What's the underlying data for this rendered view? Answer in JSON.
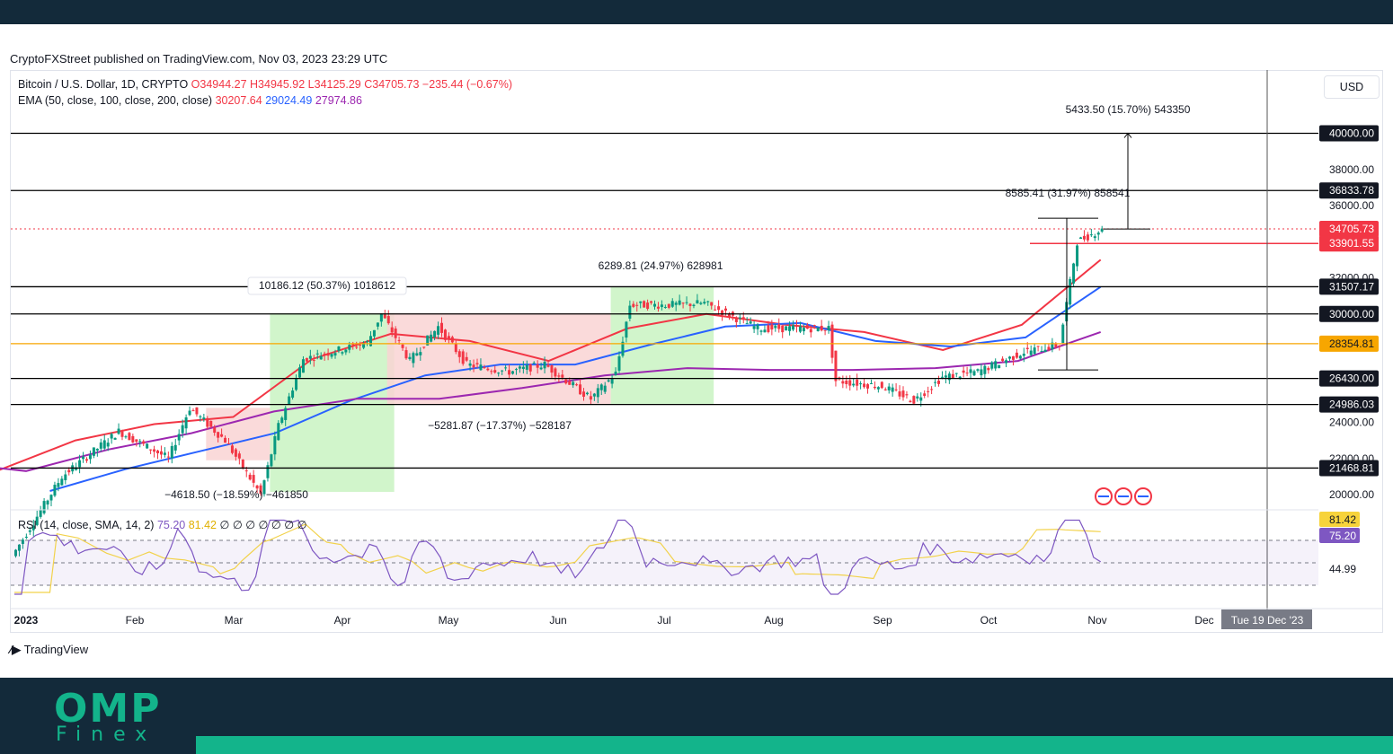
{
  "published": "CryptoFXStreet published on TradingView.com, Nov 03, 2023 23:29 UTC",
  "brand": "TradingView",
  "footer_logo": {
    "top": "OMP",
    "bottom": "Finex"
  },
  "currency_button": "USD",
  "legend": {
    "symbol": "Bitcoin / U.S. Dollar, 1D, CRYPTO",
    "open": "O34944.27",
    "high": "H34945.92",
    "low": "L34125.29",
    "close": "C34705.73",
    "change": "−235.44 (−0.67%)",
    "ema_label": "EMA (50, close, 100, close, 200, close)",
    "ema50": "30207.64",
    "ema100": "29024.49",
    "ema200": "27974.86",
    "rsi_label": "RSI (14, close, SMA, 14, 2)",
    "rsi_value": "75.20",
    "rsi_sma": "81.42",
    "rsi_extra": "∅ ∅ ∅ ∅ ∅ ∅ ∅"
  },
  "colors": {
    "ema50": "#f23645",
    "ema100": "#2962ff",
    "ema200": "#9c27b0",
    "up": "#089981",
    "down": "#f23645",
    "orange": "#f7a600"
  },
  "chart_data": {
    "type": "candlestick",
    "title": "Bitcoin / U.S. Dollar, 1D, CRYPTO",
    "ylim": [
      19500,
      41500
    ],
    "x_ticks": [
      "2023",
      "Feb",
      "Mar",
      "Apr",
      "May",
      "Jun",
      "Jul",
      "Aug",
      "Sep",
      "Oct",
      "Nov",
      "Dec"
    ],
    "y_ticks": [
      "40000.00",
      "38000.00",
      "36000.00",
      "32000.00",
      "24000.00",
      "22000.00",
      "20000.00"
    ],
    "price_labels": [
      {
        "label": "40000.00",
        "value": 40000,
        "kind": "black"
      },
      {
        "label": "36833.78",
        "value": 36833.78,
        "kind": "black"
      },
      {
        "label": "34705.73",
        "value": 34705.73,
        "kind": "red"
      },
      {
        "label": "33901.55",
        "value": 33901.55,
        "kind": "red"
      },
      {
        "label": "31507.17",
        "value": 31507.17,
        "kind": "black"
      },
      {
        "label": "30000.00",
        "value": 30000,
        "kind": "black"
      },
      {
        "label": "28354.81",
        "value": 28354.81,
        "kind": "orange"
      },
      {
        "label": "26430.00",
        "value": 26430,
        "kind": "black"
      },
      {
        "label": "24986.03",
        "value": 24986.03,
        "kind": "black"
      },
      {
        "label": "21468.81",
        "value": 21468.81,
        "kind": "black"
      }
    ],
    "levels": [
      40000,
      36833.78,
      31507.17,
      30000,
      26430,
      24986.03,
      21468.81
    ],
    "orange_level": 28354.81,
    "current_price": 34705.73,
    "annotations": [
      {
        "text": "10186.12 (50.37%) 1018612"
      },
      {
        "text": "6289.81 (24.97%) 628981"
      },
      {
        "text": "−5281.87 (−17.37%) −528187"
      },
      {
        "text": "−4618.50 (−18.59%) −461850"
      },
      {
        "text": "8585.41 (31.97%) 858541"
      },
      {
        "text": "5433.50 (15.70%) 543350"
      }
    ],
    "crosshair_date": "Tue 19 Dec '23",
    "series": [
      {
        "name": "EMA 50",
        "values": [
          21300,
          23000,
          23900,
          24300,
          27500,
          28900,
          28500,
          27400,
          29200,
          30000,
          29400,
          29000,
          28000,
          29400,
          33000
        ]
      },
      {
        "name": "EMA 100",
        "values": [
          20200,
          21400,
          22400,
          23400,
          25200,
          26600,
          27200,
          27200,
          28300,
          29300,
          29500,
          28500,
          28200,
          28700,
          31500
        ]
      },
      {
        "name": "EMA 200",
        "values": [
          21800,
          21300,
          22500,
          23400,
          24600,
          25300,
          25300,
          25900,
          26600,
          27000,
          26900,
          26900,
          27000,
          27400,
          29000
        ]
      }
    ],
    "rsi": {
      "value": 75.2,
      "sma": 81.42,
      "lower_label": "44.99"
    }
  }
}
